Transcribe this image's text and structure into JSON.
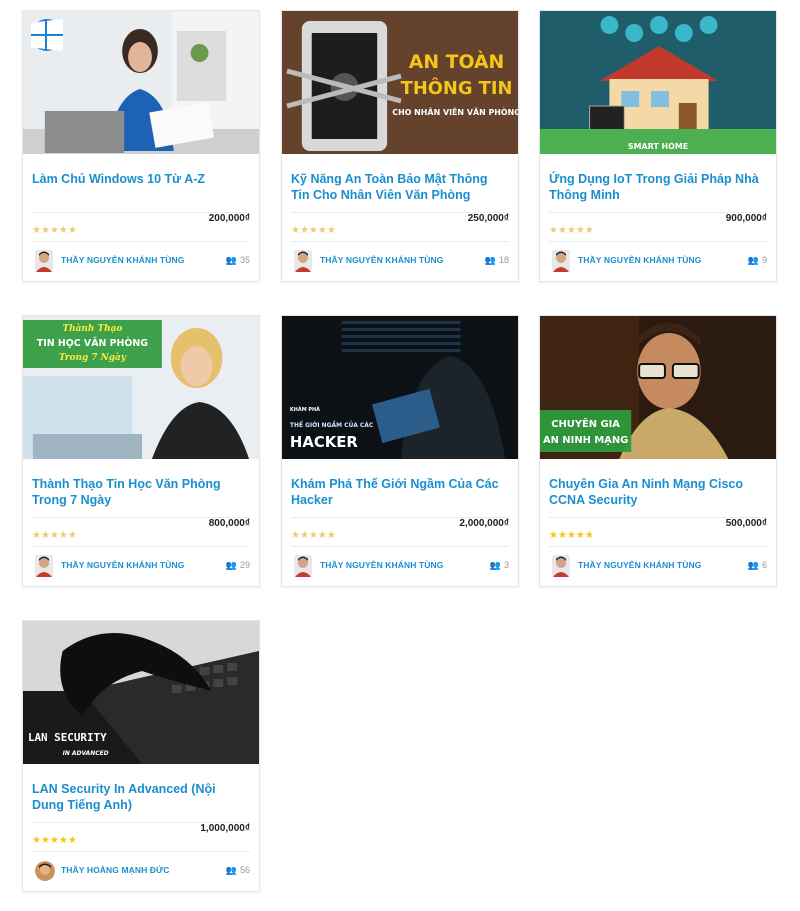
{
  "courses": [
    {
      "title": "Làm Chủ Windows 10 Từ A-Z",
      "price": "200,000₫",
      "rating_stars": 0,
      "stars": "★★★★★",
      "author": "THẦY NGUYỄN KHÁNH TÙNG",
      "students": "35",
      "thumb_text": []
    },
    {
      "title": "Kỹ Năng An Toàn Bảo Mật Thông Tin Cho Nhân Viên Văn Phòng",
      "price": "250,000₫",
      "rating_stars": 0,
      "stars": "★★★★★",
      "author": "THẦY NGUYỄN KHÁNH TÙNG",
      "students": "18",
      "thumb_text": [
        "AN TOÀN",
        "THÔNG TIN",
        "CHO NHÂN VIÊN VĂN PHÒNG"
      ]
    },
    {
      "title": "Ứng Dụng IoT Trong Giải Pháp Nhà Thông Minh",
      "price": "900,000₫",
      "rating_stars": 0,
      "stars": "★★★★★",
      "author": "THẦY NGUYỄN KHÁNH TÙNG",
      "students": "9",
      "thumb_text": [
        "SMART HOME"
      ]
    },
    {
      "title": "Thành Thạo Tin Học Văn Phòng Trong 7 Ngày",
      "price": "800,000₫",
      "rating_stars": 0,
      "stars": "★★★★★",
      "author": "THẦY NGUYỄN KHÁNH TÙNG",
      "students": "29",
      "thumb_text": [
        "Thành Thạo",
        "TIN HỌC VĂN PHÒNG",
        "Trong 7 Ngày"
      ]
    },
    {
      "title": "Khám Phá Thế Giới Ngầm Của Các Hacker",
      "price": "2,000,000₫",
      "rating_stars": 0,
      "stars": "★★★★★",
      "author": "THẦY NGUYỄN KHÁNH TÙNG",
      "students": "3",
      "thumb_text": [
        "KHÁM PHÁ",
        "THẾ GIỚI NGẦM CỦA CÁC",
        "HACKER"
      ]
    },
    {
      "title": "Chuyên Gia An Ninh Mạng Cisco CCNA Security",
      "price": "500,000₫",
      "rating_stars": 5,
      "stars": "★★★★★",
      "author": "THẦY NGUYỄN KHÁNH TÙNG",
      "students": "6",
      "thumb_text": [
        "CHUYÊN GIA",
        "AN NINH MẠNG"
      ]
    },
    {
      "title": "LAN Security In Advanced (Nội Dung Tiếng Anh)",
      "price": "1,000,000₫",
      "rating_stars": 5,
      "stars": "★★★★★",
      "author": "THẦY HOÀNG MẠNH ĐỨC",
      "students": "56",
      "thumb_text": [
        "LAN SECURITY",
        "IN ADVANCED"
      ]
    }
  ],
  "colors": {
    "accent": "#1a8fce",
    "star_filled": "#f5c518",
    "star_empty": "#d9a400"
  },
  "icons": {
    "students": "users-icon",
    "windows": "windows-logo-icon"
  }
}
